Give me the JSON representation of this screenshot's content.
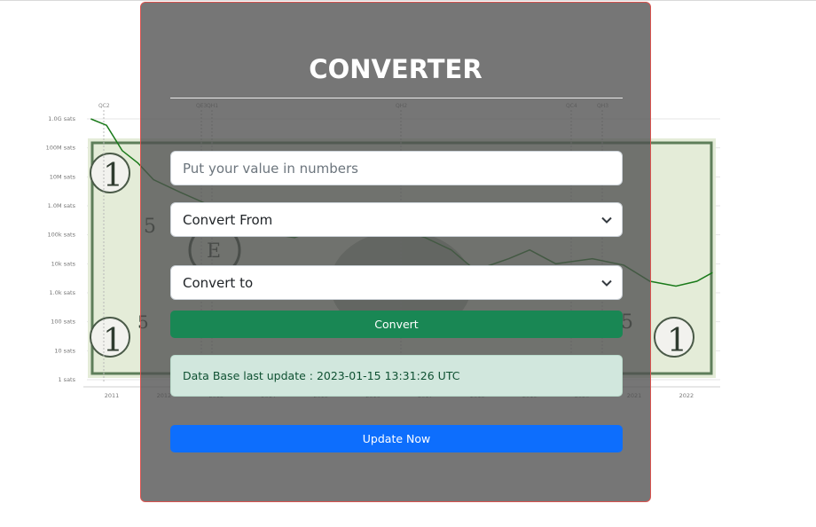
{
  "converter": {
    "title": "CONVERTER",
    "value_input": {
      "placeholder": "Put your value in numbers",
      "value": ""
    },
    "convert_from": {
      "selected": "Convert From"
    },
    "convert_to": {
      "selected": "Convert to"
    },
    "convert_button": "Convert",
    "db_status": "Data Base last update : 2023-01-15 13:31:26 UTC",
    "update_button": "Update Now"
  },
  "colors": {
    "panel_border": "#d9534f",
    "convert_button": "#198754",
    "update_button": "#0d6efd",
    "alert_bg": "#d1e7dd",
    "line": "#1a7a1a",
    "bill_green": "#5e7e5a"
  },
  "chart_data": {
    "type": "line",
    "title": "",
    "xlabel": "",
    "ylabel": "",
    "y_scale": "log",
    "y_ticks": [
      "1.0G sats",
      "100M sats",
      "10M sats",
      "1.0M sats",
      "100k sats",
      "10k sats",
      "1.0k sats",
      "100 sats",
      "10 sats",
      "1 sats"
    ],
    "x_ticks": [
      "2011",
      "2012",
      "2013",
      "2014",
      "2015",
      "2016",
      "2017",
      "2018",
      "2019",
      "2020",
      "2021",
      "2022"
    ],
    "annotations": [
      "QC2",
      "QE3",
      "QH1",
      "QH2",
      "QC4",
      "QH3"
    ],
    "series": [
      {
        "x": [
          2010.6,
          2010.9,
          2011.2,
          2011.5,
          2011.8,
          2012.3,
          2012.9,
          2013.3,
          2013.9,
          2014.5,
          2015.1,
          2015.8,
          2016.5,
          2017.0,
          2017.5,
          2017.96,
          2018.6,
          2019.0,
          2019.5,
          2020.2,
          2020.8,
          2021.3,
          2021.8,
          2022.2,
          2022.5
        ],
        "y": [
          1000000000,
          600000000,
          80000000,
          30000000,
          8000000,
          3000000,
          1000000,
          400000,
          120000,
          80000,
          200000,
          200000,
          150000,
          80000,
          30000,
          6000,
          15000,
          30000,
          10000,
          15000,
          9000,
          2500,
          1700,
          2500,
          5000
        ]
      }
    ]
  }
}
